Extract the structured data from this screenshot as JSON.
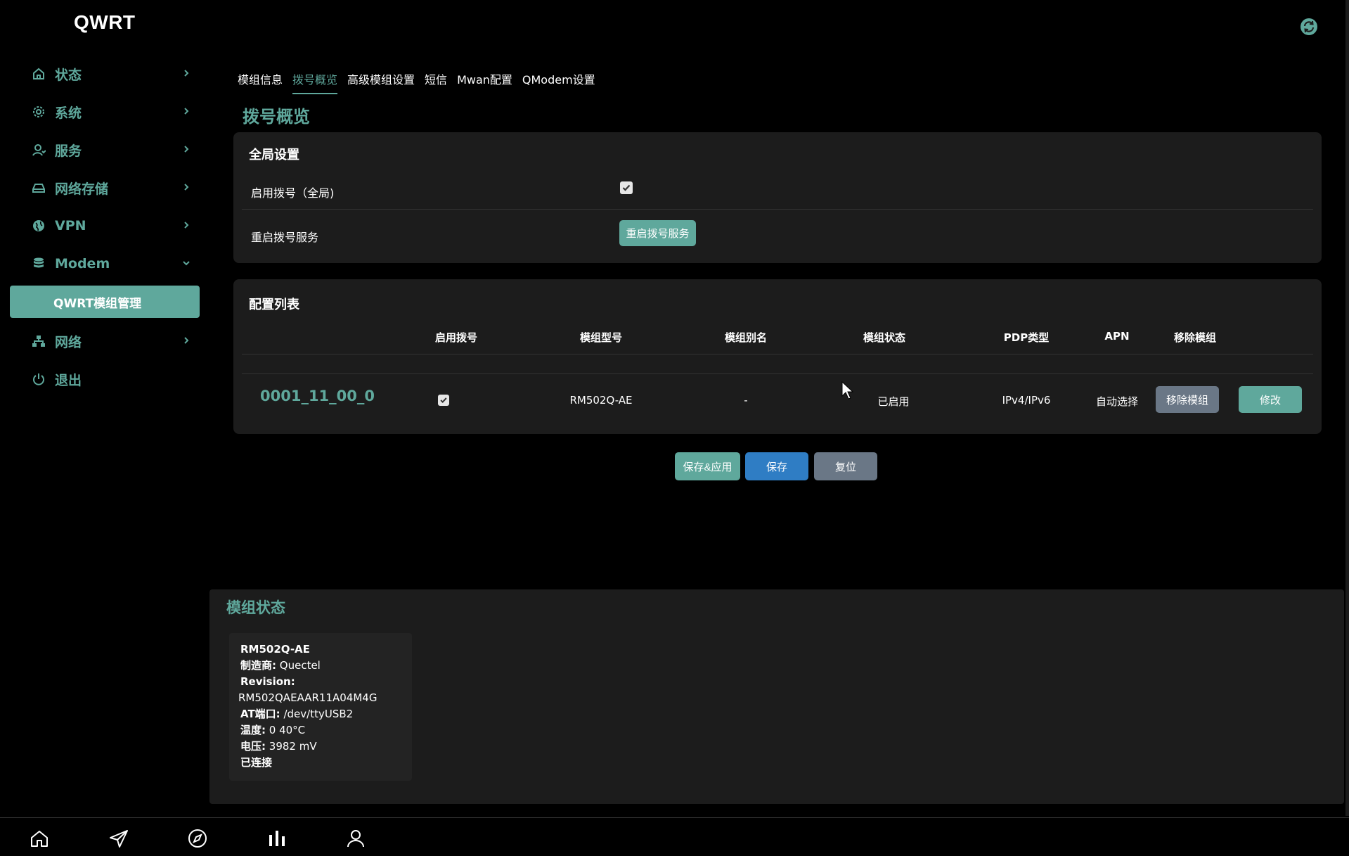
{
  "app": {
    "brand": "QWRT"
  },
  "sidebar": {
    "items": [
      {
        "label": "状态",
        "icon": "home-icon"
      },
      {
        "label": "系统",
        "icon": "gear-icon"
      },
      {
        "label": "服务",
        "icon": "user-service-icon"
      },
      {
        "label": "网络存储",
        "icon": "drive-icon"
      },
      {
        "label": "VPN",
        "icon": "globe-icon"
      },
      {
        "label": "Modem",
        "icon": "database-icon"
      },
      {
        "label": "网络",
        "icon": "network-icon"
      },
      {
        "label": "退出",
        "icon": "power-icon"
      }
    ],
    "active_sub": "QWRT模组管理"
  },
  "tabs": [
    {
      "label": "模组信息"
    },
    {
      "label": "拨号概览",
      "active": true
    },
    {
      "label": "高级模组设置"
    },
    {
      "label": "短信"
    },
    {
      "label": "Mwan配置"
    },
    {
      "label": "QModem设置"
    }
  ],
  "page_title": "拨号概览",
  "global": {
    "title": "全局设置",
    "enable_label": "启用拨号（全局)",
    "enable_checked": true,
    "restart_label": "重启拨号服务",
    "restart_button": "重启拨号服务"
  },
  "config": {
    "title": "配置列表",
    "headers": [
      "启用拨号",
      "模组型号",
      "模组别名",
      "模组状态",
      "PDP类型",
      "APN",
      "移除模组"
    ],
    "row": {
      "id": "0001_11_00_0",
      "enabled": true,
      "model": "RM502Q-AE",
      "alias": "-",
      "status": "已启用",
      "pdp": "IPv4/IPv6",
      "apn": "自动选择",
      "remove_button": "移除模组",
      "edit_button": "修改"
    }
  },
  "actions": {
    "save_apply": "保存&应用",
    "save": "保存",
    "reset": "复位"
  },
  "module_status": {
    "title": "模组状态",
    "model": "RM502Q-AE",
    "vendor_label": "制造商:",
    "vendor": "Quectel",
    "revision_label": "Revision:",
    "revision": "RM502QAEAAR11A04M4G",
    "at_port_label": "AT端口:",
    "at_port": "/dev/ttyUSB2",
    "temp_label": "温度:",
    "temp": "0 40°C",
    "voltage_label": "电压:",
    "voltage": "3982 mV",
    "connection": "已连接"
  },
  "bottom_bar": [
    "home-icon",
    "send-icon",
    "compass-icon",
    "bar-chart-icon",
    "user-icon"
  ],
  "colors": {
    "accent": "#5fa89c",
    "blue": "#2f7dc4",
    "grey": "#6a7786",
    "panel": "#1c1c1c"
  }
}
